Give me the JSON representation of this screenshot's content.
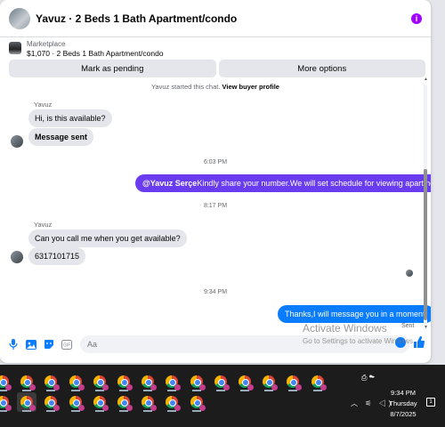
{
  "header": {
    "title": "Yavuz · 2 Beds 1 Bath Apartment/condo",
    "info_icon": "info-icon"
  },
  "listing": {
    "label": "Marketplace",
    "price_title": "$1,070 · 2 Beds 1 Bath Apartment/condo"
  },
  "actions": {
    "pending_label": "Mark as pending",
    "more_label": "More options"
  },
  "conversation": {
    "system_note_prefix": "Yavuz started this chat.",
    "system_note_link": "View buyer profile",
    "sender_name_1": "Yavuz",
    "msg_1": "Hi, is this available?",
    "msg_2": "Message sent",
    "time_1": "6:03 PM",
    "out_mention": "@Yavuz Serçe",
    "out_msg_1": "Kindly share your number.We will set schedule for viewing apartment",
    "time_2": "8:17 PM",
    "sender_name_2": "Yavuz",
    "msg_3": "Can you call me when you get available?",
    "msg_4": "6317101715",
    "time_3": "9:34 PM",
    "out_msg_2": "Thanks,I will message you in a moment.",
    "status": "Sent"
  },
  "composer": {
    "placeholder": "Aa"
  },
  "watermark": {
    "line1": "Activate Windows",
    "line2": "Go to Settings to activate Windows."
  },
  "taskbar": {
    "time": "9:34 PM",
    "day": "Thursday",
    "date": "8/7/2025"
  },
  "colors": {
    "accent_blue": "#0a7cff",
    "mention_purple": "#6a3cf0",
    "info_purple": "#a100ff"
  }
}
